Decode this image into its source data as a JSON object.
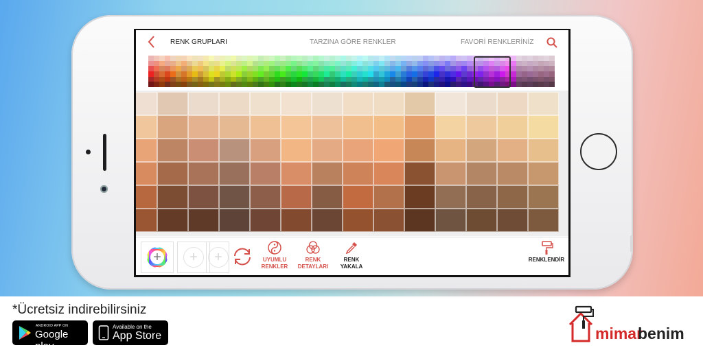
{
  "header": {
    "back_icon": "chevron-left-icon",
    "tabs": [
      {
        "label": "RENK GRUPLARI",
        "active": true
      },
      {
        "label": "TARZINA GÖRE RENKLER",
        "active": false
      },
      {
        "label": "FAVORİ RENKLERİNİZ",
        "active": false
      }
    ],
    "search_icon": "search-icon"
  },
  "colors": {
    "accent": "#d5514c",
    "active_tab": "#222222",
    "inactive_tab": "#8a8a8a"
  },
  "swatch_grid": {
    "rows": [
      [
        "#efdfd2",
        "#e0c8b3",
        "#eadbcc",
        "#ecd9c6",
        "#efdfcd",
        "#f2e1cf",
        "#ede0d1",
        "#f1dcc6",
        "#f0dcc3",
        "#e3c9a8",
        "#f1e5da",
        "#eadbca",
        "#ecd8c3",
        "#efe1c9"
      ],
      [
        "#f0c79c",
        "#d9a57f",
        "#e4b28e",
        "#e5b992",
        "#f0c095",
        "#f3c597",
        "#eec19a",
        "#f1bf8e",
        "#f3bd87",
        "#e5a26e",
        "#f4d3a2",
        "#eec99e",
        "#f1cf9a",
        "#f4dba2"
      ],
      [
        "#e8a377",
        "#bd8563",
        "#c98e74",
        "#b8927d",
        "#d9a07f",
        "#f2b685",
        "#e4aa84",
        "#e9a47a",
        "#f0a775",
        "#c88757",
        "#e6b382",
        "#d3a67e",
        "#e2b084",
        "#e6bf8c"
      ],
      [
        "#d88b5f",
        "#a56a4a",
        "#a9735a",
        "#98705c",
        "#b98067",
        "#d98e67",
        "#ba815e",
        "#ce8359",
        "#d8865a",
        "#8b5232",
        "#c89570",
        "#b38665",
        "#ba8a66",
        "#c7986e"
      ],
      [
        "#b8683f",
        "#7c4d33",
        "#7e5240",
        "#705446",
        "#8d5e49",
        "#b86a48",
        "#875c44",
        "#c26b41",
        "#b2704b",
        "#6b3c22",
        "#926e55",
        "#886249",
        "#8e6749",
        "#9b7552"
      ],
      [
        "#9a5533",
        "#643b26",
        "#5f3a28",
        "#5e4438",
        "#6f4635",
        "#824a2f",
        "#6c4634",
        "#94522f",
        "#8a5233",
        "#5d3621",
        "#6f5541",
        "#6e4c33",
        "#6f4c36",
        "#7d5a3e"
      ]
    ]
  },
  "toolbar": {
    "slot_icon": "plus-icon",
    "refresh_icon": "refresh-icon",
    "tools": [
      {
        "label": "UYUMLU\nRENKLER",
        "icon": "yin-yang-icon"
      },
      {
        "label": "RENK\nDETAYLARI",
        "icon": "color-circles-icon"
      },
      {
        "label": "RENK\nYAKALA",
        "icon": "eyedropper-icon"
      }
    ],
    "apply_label": "RENKLENDİR",
    "apply_icon": "paint-roller-icon"
  },
  "promo": {
    "text": "*Ücretsiz indirebilirsiniz",
    "google_play": {
      "small": "ANDROID APP ON",
      "big": "Google play"
    },
    "app_store": {
      "small": "Available on the",
      "big": "App Store"
    }
  },
  "brand": {
    "part1": "mimar",
    "part2": "benim",
    "color1": "#d42a2a",
    "color2": "#222222"
  }
}
